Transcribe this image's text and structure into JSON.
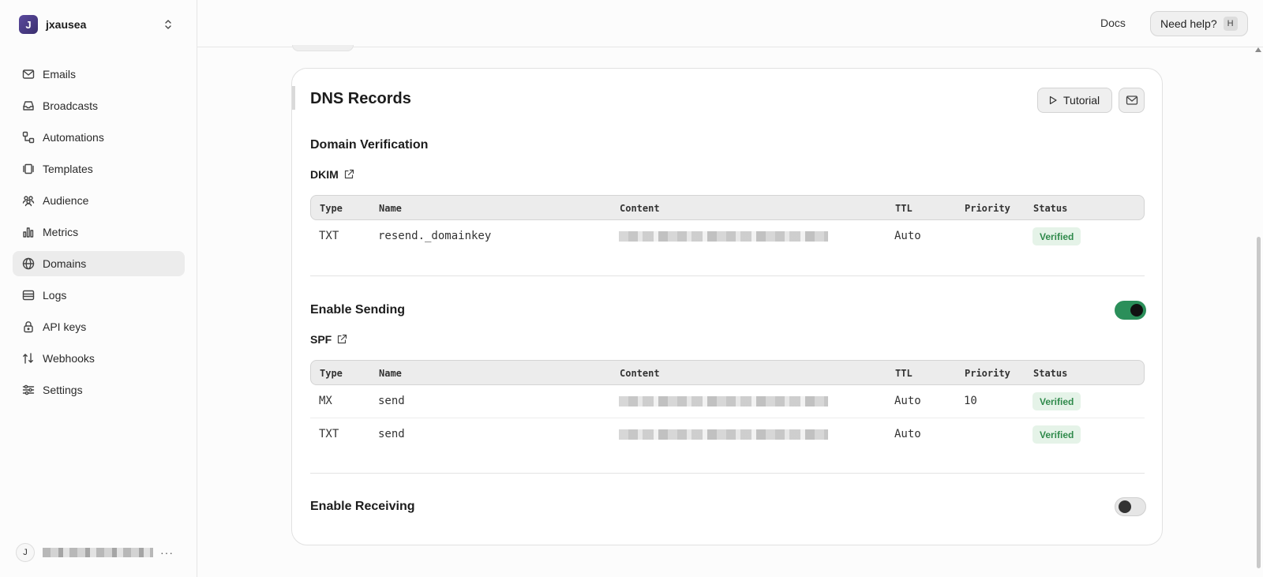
{
  "workspace": {
    "initial": "J",
    "name": "jxausea"
  },
  "sidebar": {
    "items": [
      {
        "label": "Emails",
        "icon": "mail-icon"
      },
      {
        "label": "Broadcasts",
        "icon": "inbox-icon"
      },
      {
        "label": "Automations",
        "icon": "workflow-icon"
      },
      {
        "label": "Templates",
        "icon": "templates-icon"
      },
      {
        "label": "Audience",
        "icon": "users-icon"
      },
      {
        "label": "Metrics",
        "icon": "bar-chart-icon"
      },
      {
        "label": "Domains",
        "icon": "globe-icon",
        "active": true
      },
      {
        "label": "Logs",
        "icon": "logs-icon"
      },
      {
        "label": "API keys",
        "icon": "lock-icon"
      },
      {
        "label": "Webhooks",
        "icon": "webhook-icon"
      },
      {
        "label": "Settings",
        "icon": "sliders-icon"
      }
    ],
    "user": {
      "initial": "J",
      "more": "···"
    }
  },
  "topbar": {
    "docs": "Docs",
    "help": "Need help?",
    "help_key": "H"
  },
  "card": {
    "title": "DNS Records",
    "tutorial": "Tutorial",
    "domain_verification": {
      "title": "Domain Verification",
      "record_label": "DKIM",
      "headers": [
        "Type",
        "Name",
        "Content",
        "TTL",
        "Priority",
        "Status"
      ],
      "rows": [
        {
          "type": "TXT",
          "name": "resend._domainkey",
          "ttl": "Auto",
          "priority": "",
          "status": "Verified"
        }
      ]
    },
    "enable_sending": {
      "title": "Enable Sending",
      "enabled": true,
      "record_label": "SPF",
      "headers": [
        "Type",
        "Name",
        "Content",
        "TTL",
        "Priority",
        "Status"
      ],
      "rows": [
        {
          "type": "MX",
          "name": "send",
          "ttl": "Auto",
          "priority": "10",
          "status": "Verified"
        },
        {
          "type": "TXT",
          "name": "send",
          "ttl": "Auto",
          "priority": "",
          "status": "Verified"
        }
      ]
    },
    "enable_receiving": {
      "title": "Enable Receiving",
      "enabled": false
    }
  },
  "colors": {
    "accent_green": "#2b8f5a",
    "verified_bg": "#e5f3e8",
    "verified_text": "#2f8a4b",
    "workspace_avatar": "#4a3b8c"
  }
}
